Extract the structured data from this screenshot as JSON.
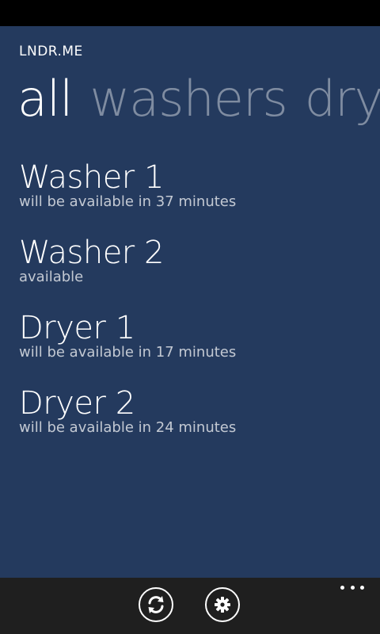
{
  "app": {
    "title": "LNDR.ME",
    "background_color": "#243a5e"
  },
  "pivot": {
    "items": [
      {
        "label": "all",
        "active": true
      },
      {
        "label": "washers",
        "active": false
      },
      {
        "label": "dryers",
        "active": false
      }
    ]
  },
  "machines": [
    {
      "name": "Washer 1",
      "status": "will be available in 37 minutes"
    },
    {
      "name": "Washer 2",
      "status": "available"
    },
    {
      "name": "Dryer 1",
      "status": "will be available in 17 minutes"
    },
    {
      "name": "Dryer 2",
      "status": "will be available in 24 minutes"
    }
  ],
  "app_bar": {
    "buttons": [
      {
        "icon": "refresh-icon"
      },
      {
        "icon": "gear-icon"
      }
    ],
    "more_icon": "ellipsis-icon"
  }
}
